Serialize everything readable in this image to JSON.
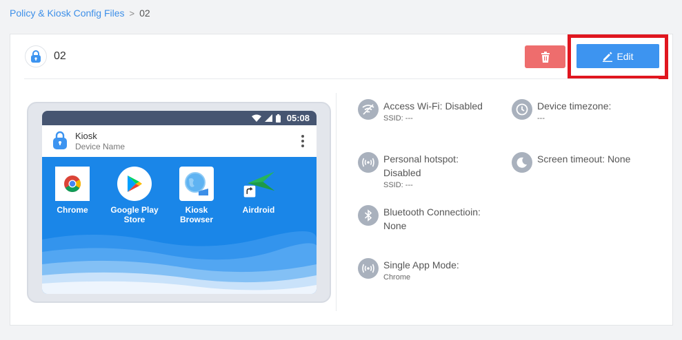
{
  "breadcrumb": {
    "parent": "Policy & Kiosk Config Files",
    "separator": ">",
    "current": "02"
  },
  "header": {
    "title": "02",
    "edit_label": "Edit"
  },
  "phone": {
    "time": "05:08",
    "app_name": "Kiosk",
    "device_name": "Device Name",
    "apps": [
      {
        "label_line1": "Chrome",
        "label_line2": ""
      },
      {
        "label_line1": "Google Play",
        "label_line2": "Store"
      },
      {
        "label_line1": "Kiosk",
        "label_line2": "Browser"
      },
      {
        "label_line1": "Airdroid",
        "label_line2": ""
      }
    ]
  },
  "settings": {
    "wifi": {
      "title": "Access Wi-Fi: Disabled",
      "sub": "SSID: ---"
    },
    "timezone": {
      "title": "Device timezone:",
      "sub": "---"
    },
    "hotspot": {
      "title_line1": "Personal hotspot:",
      "title_line2": "Disabled",
      "sub": "SSID: ---"
    },
    "screen_timeout": {
      "title": "Screen timeout: None"
    },
    "bluetooth": {
      "title_line1": "Bluetooth Connectioin:",
      "title_line2": "None"
    },
    "single_app": {
      "title": "Single App Mode:",
      "sub": "Chrome"
    }
  },
  "colors": {
    "accent": "#3d94f0",
    "danger": "#ee6d6d",
    "highlight": "#e0161f",
    "status_bar": "#465571",
    "home_blue": "#1a86e8"
  }
}
